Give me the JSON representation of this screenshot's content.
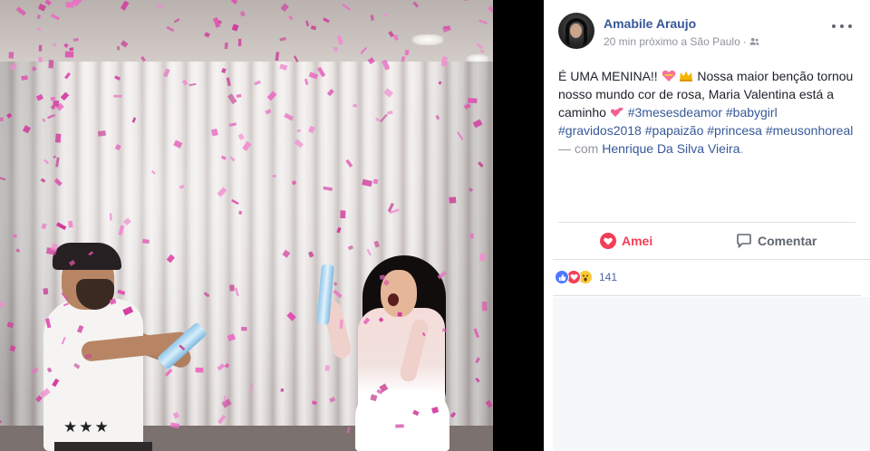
{
  "post": {
    "author": "Amabile Araujo",
    "time": "20 min",
    "location": "próximo a São Paulo",
    "separator": "·",
    "privacy_icon": "friends-icon",
    "more_icon": "more-options-icon",
    "text": {
      "line1_before": "É UMA MENINA!!",
      "line1_after": "Nossa maior benção tornou nosso mundo cor de rosa, Maria Valentina está a caminho",
      "emojis": [
        "heart-ribbon-emoji",
        "crown-emoji",
        "two-hearts-emoji"
      ],
      "hashtags": [
        "#3mesesdeamor",
        "#babygirl",
        "#gravidos2018",
        "#papaizão",
        "#princesa",
        "#meusonhoreal"
      ],
      "with_label": "— com",
      "tagged_person": "Henrique Da Silva Vieira",
      "period": "."
    }
  },
  "actions": {
    "love_label": "Amei",
    "comment_label": "Comentar"
  },
  "reactions": {
    "types": [
      "like-reaction-icon",
      "love-reaction-icon",
      "wow-reaction-icon"
    ],
    "count": "141"
  },
  "colors": {
    "link": "#365899",
    "love": "#f33e58",
    "meta": "#90949c",
    "confetti": "#e04fb0"
  }
}
